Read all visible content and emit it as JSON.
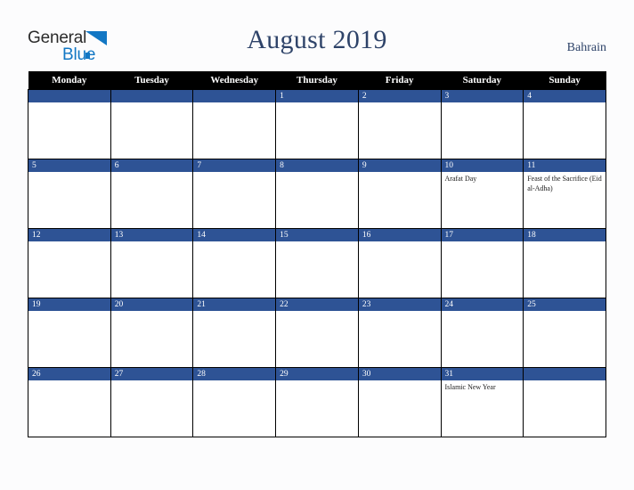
{
  "brand": {
    "name_part1": "General",
    "name_part2": "Blue",
    "triangle_icon": "triangle-icon",
    "colors": {
      "text": "#2b2b2b",
      "accent": "#1277c4"
    }
  },
  "header": {
    "title": "August 2019",
    "region": "Bahrain",
    "title_color": "#2e4369"
  },
  "calendar": {
    "weekday_headers": [
      "Monday",
      "Tuesday",
      "Wednesday",
      "Thursday",
      "Friday",
      "Saturday",
      "Sunday"
    ],
    "header_bg": "#000000",
    "daybar_bg": "#2e5395",
    "weeks": [
      [
        {
          "day": "",
          "blank": true,
          "events": []
        },
        {
          "day": "",
          "blank": true,
          "events": []
        },
        {
          "day": "",
          "blank": true,
          "events": []
        },
        {
          "day": "1",
          "blank": false,
          "events": []
        },
        {
          "day": "2",
          "blank": false,
          "events": []
        },
        {
          "day": "3",
          "blank": false,
          "events": []
        },
        {
          "day": "4",
          "blank": false,
          "events": []
        }
      ],
      [
        {
          "day": "5",
          "blank": false,
          "events": []
        },
        {
          "day": "6",
          "blank": false,
          "events": []
        },
        {
          "day": "7",
          "blank": false,
          "events": []
        },
        {
          "day": "8",
          "blank": false,
          "events": []
        },
        {
          "day": "9",
          "blank": false,
          "events": []
        },
        {
          "day": "10",
          "blank": false,
          "events": [
            "Arafat Day"
          ]
        },
        {
          "day": "11",
          "blank": false,
          "events": [
            "Feast of the Sacrifice (Eid al-Adha)"
          ]
        }
      ],
      [
        {
          "day": "12",
          "blank": false,
          "events": []
        },
        {
          "day": "13",
          "blank": false,
          "events": []
        },
        {
          "day": "14",
          "blank": false,
          "events": []
        },
        {
          "day": "15",
          "blank": false,
          "events": []
        },
        {
          "day": "16",
          "blank": false,
          "events": []
        },
        {
          "day": "17",
          "blank": false,
          "events": []
        },
        {
          "day": "18",
          "blank": false,
          "events": []
        }
      ],
      [
        {
          "day": "19",
          "blank": false,
          "events": []
        },
        {
          "day": "20",
          "blank": false,
          "events": []
        },
        {
          "day": "21",
          "blank": false,
          "events": []
        },
        {
          "day": "22",
          "blank": false,
          "events": []
        },
        {
          "day": "23",
          "blank": false,
          "events": []
        },
        {
          "day": "24",
          "blank": false,
          "events": []
        },
        {
          "day": "25",
          "blank": false,
          "events": []
        }
      ],
      [
        {
          "day": "26",
          "blank": false,
          "events": []
        },
        {
          "day": "27",
          "blank": false,
          "events": []
        },
        {
          "day": "28",
          "blank": false,
          "events": []
        },
        {
          "day": "29",
          "blank": false,
          "events": []
        },
        {
          "day": "30",
          "blank": false,
          "events": []
        },
        {
          "day": "31",
          "blank": false,
          "events": [
            "Islamic New Year"
          ]
        },
        {
          "day": "",
          "blank": true,
          "events": []
        }
      ]
    ]
  }
}
